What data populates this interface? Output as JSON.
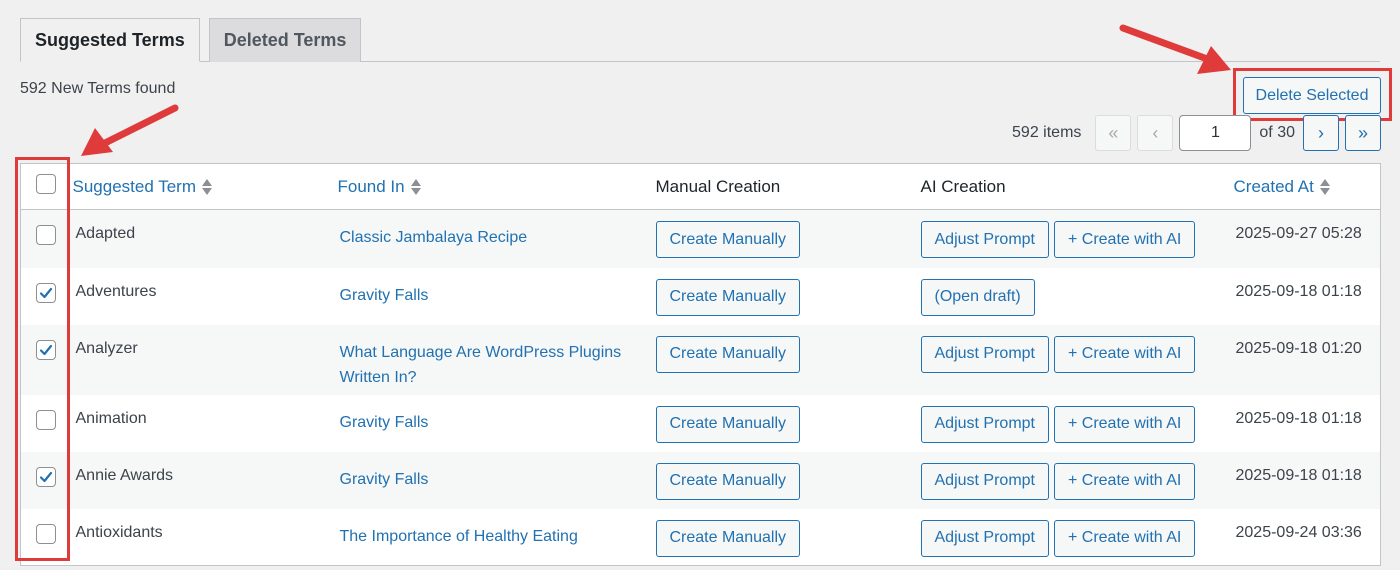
{
  "tabs": [
    {
      "label": "Suggested Terms",
      "active": true
    },
    {
      "label": "Deleted Terms",
      "active": false
    }
  ],
  "summary": "592 New Terms found",
  "delete_button": "Delete Selected",
  "pagination": {
    "items_count": "592 items",
    "first": "«",
    "prev": "‹",
    "current_page": "1",
    "of_label": "of 30",
    "next": "›",
    "last": "»"
  },
  "columns": {
    "term": "Suggested Term",
    "found_in": "Found In",
    "manual": "Manual Creation",
    "ai": "AI Creation",
    "created": "Created At"
  },
  "rows": [
    {
      "checked": false,
      "term": "Adapted",
      "found_in": "Classic Jambalaya Recipe",
      "manual": "Create Manually",
      "ai_buttons": [
        "Adjust Prompt",
        "+ Create with AI"
      ],
      "created": "2025-09-27 05:28"
    },
    {
      "checked": true,
      "term": "Adventures",
      "found_in": "Gravity Falls",
      "manual": "Create Manually",
      "ai_buttons": [
        "(Open draft)"
      ],
      "created": "2025-09-18 01:18"
    },
    {
      "checked": true,
      "term": "Analyzer",
      "found_in": "What Language Are WordPress Plugins Written In?",
      "manual": "Create Manually",
      "ai_buttons": [
        "Adjust Prompt",
        "+ Create with AI"
      ],
      "created": "2025-09-18 01:20"
    },
    {
      "checked": false,
      "term": "Animation",
      "found_in": "Gravity Falls",
      "manual": "Create Manually",
      "ai_buttons": [
        "Adjust Prompt",
        "+ Create with AI"
      ],
      "created": "2025-09-18 01:18"
    },
    {
      "checked": true,
      "term": "Annie Awards",
      "found_in": "Gravity Falls",
      "manual": "Create Manually",
      "ai_buttons": [
        "Adjust Prompt",
        "+ Create with AI"
      ],
      "created": "2025-09-18 01:18"
    },
    {
      "checked": false,
      "term": "Antioxidants",
      "found_in": "The Importance of Healthy Eating",
      "manual": "Create Manually",
      "ai_buttons": [
        "Adjust Prompt",
        "+ Create with AI"
      ],
      "created": "2025-09-24 03:36"
    }
  ],
  "colors": {
    "accent": "#2271b1",
    "highlight": "#e03b3b",
    "background": "#f0f0f1"
  },
  "icons": {
    "checkmark": "checkmark-icon",
    "sort": "sort-arrows-icon",
    "annotation_arrow": "red-arrow-icon"
  }
}
